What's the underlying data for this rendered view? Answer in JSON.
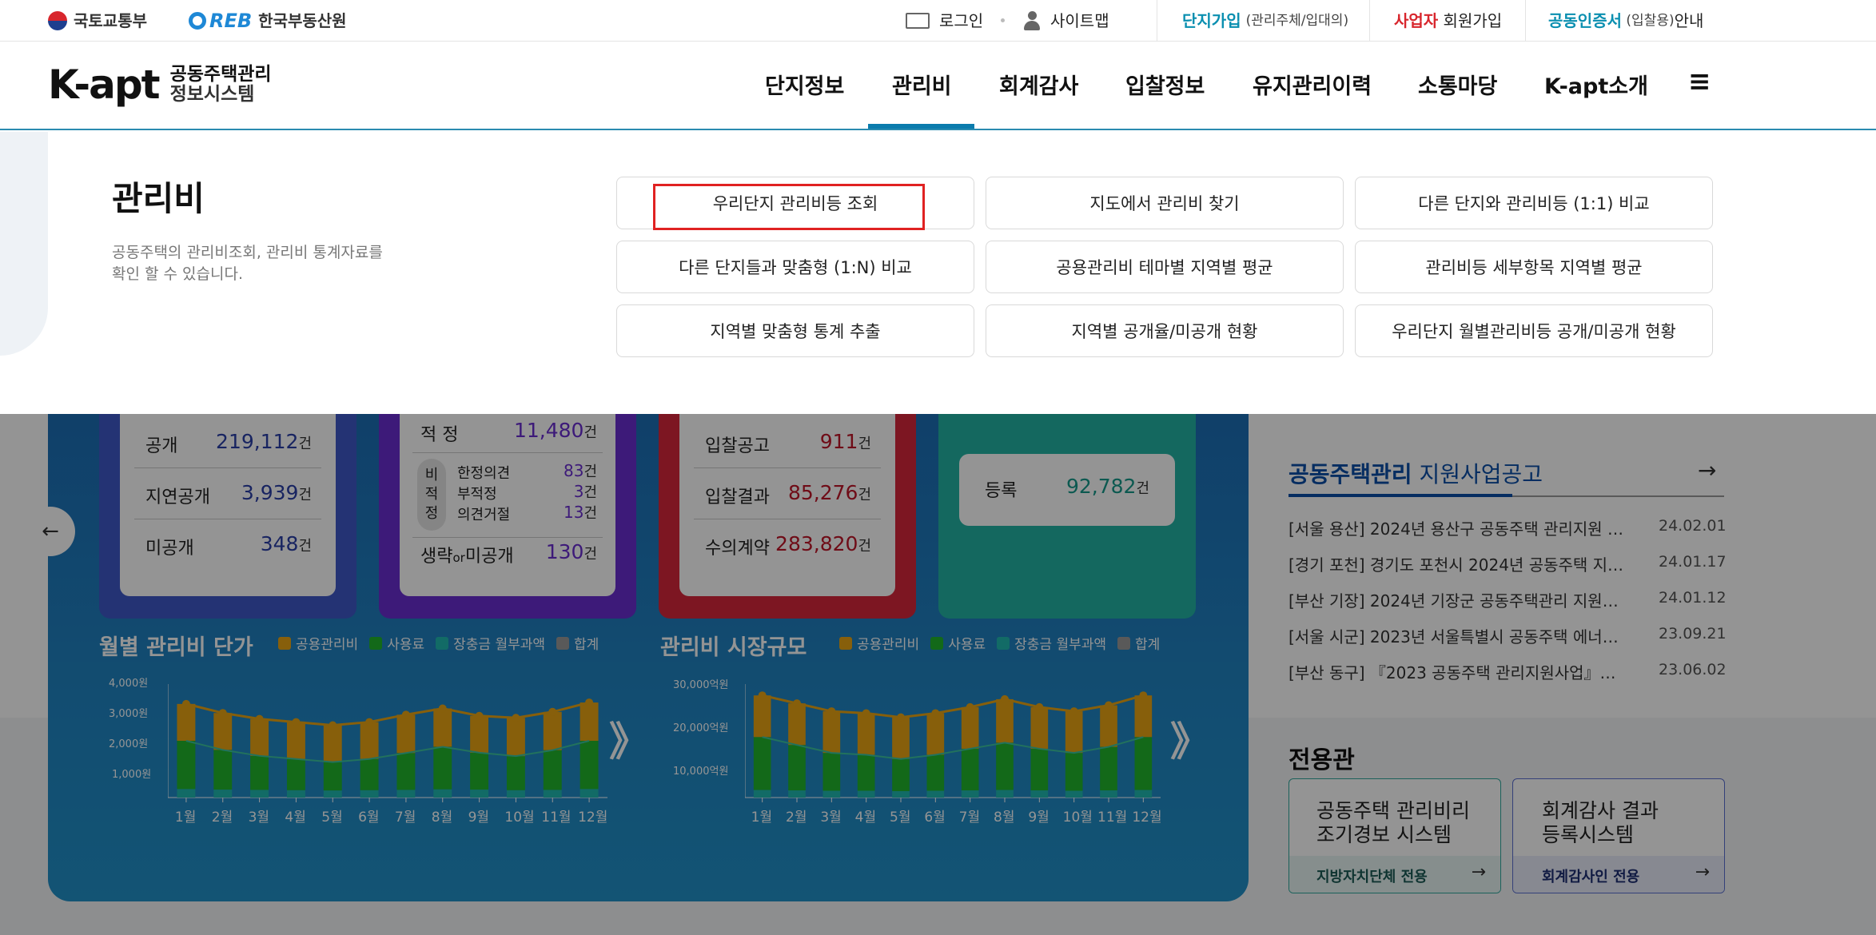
{
  "util": {
    "gov1": "국토교통부",
    "gov2_logo": "REB",
    "gov2": "한국부동산원",
    "login": "로그인",
    "sitemap": "사이트맵",
    "join_hl": "단지가입",
    "join_sub": "(관리주체/입대의)",
    "biz_hl": "사업자",
    "biz_rest": " 회원가입",
    "cert_hl": "공동인증서",
    "cert_sub": " (입찰용)",
    "cert_rest": "안내"
  },
  "logo": {
    "main": "K-apt",
    "line1": "공동주택관리",
    "line2": "정보시스템"
  },
  "nav": [
    "단지정보",
    "관리비",
    "회계감사",
    "입찰정보",
    "유지관리이력",
    "소통마당",
    "K-apt소개"
  ],
  "menu_icon": "≡",
  "mega": {
    "title": "관리비",
    "desc1": "공동주택의 관리비조회, 관리비 통계자료를",
    "desc2": "확인 할 수 있습니다.",
    "items": [
      "우리단지 관리비등 조회",
      "지도에서 관리비 찾기",
      "다른 단지와 관리비등 (1:1) 비교",
      "다른 단지들과 맞춤형 (1:N) 비교",
      "공용관리비 테마별 지역별 평균",
      "관리비등 세부항목 지역별 평균",
      "지역별 맞춤형 통계 추출",
      "지역별 공개율/미공개 현황",
      "우리단지 월별관리비등 공개/미공개 현황"
    ]
  },
  "stats": {
    "card1": [
      {
        "label": "공개",
        "value": "219,112",
        "unit": "건"
      },
      {
        "label": "지연공개",
        "value": "3,939",
        "unit": "건"
      },
      {
        "label": "미공개",
        "value": "348",
        "unit": "건"
      }
    ],
    "card2": {
      "top_label": "적 정",
      "top_value": "11,480",
      "unit": "건",
      "badge": [
        "비",
        "적",
        "정"
      ],
      "sub": [
        {
          "label": "한정의견",
          "value": "83"
        },
        {
          "label": "부적정",
          "value": "3"
        },
        {
          "label": "의견거절",
          "value": "13"
        }
      ],
      "bottom_label_a": "생략",
      "bottom_label_or": "or",
      "bottom_label_b": "미공개",
      "bottom_value": "130"
    },
    "card3": [
      {
        "label": "입찰공고",
        "value": "911",
        "unit": "건"
      },
      {
        "label": "입찰결과",
        "value": "85,276",
        "unit": "건"
      },
      {
        "label": "수의계약",
        "value": "283,820",
        "unit": "건"
      }
    ],
    "card4": {
      "label": "등록",
      "value": "92,782",
      "unit": "건"
    }
  },
  "legend": [
    "공용관리비",
    "사용료",
    "장충금 월부과액",
    "합계"
  ],
  "legend_colors": [
    "#e8a413",
    "#22b52c",
    "#20b8b0",
    "#999999"
  ],
  "arrow_glyph": "》",
  "chart_data": [
    {
      "type": "bar",
      "title": "월별 관리비 단가",
      "categories": [
        "1월",
        "2월",
        "3월",
        "4월",
        "5월",
        "6월",
        "7월",
        "8월",
        "9월",
        "10월",
        "11월",
        "12월"
      ],
      "yticks": [
        "4,000원",
        "3,000원",
        "2,000원",
        "1,000원"
      ],
      "ylim": [
        0,
        4000
      ],
      "series": [
        {
          "name": "장충금 월부과액",
          "values": [
            300,
            280,
            270,
            260,
            250,
            260,
            270,
            290,
            280,
            260,
            270,
            300
          ]
        },
        {
          "name": "사용료",
          "values": [
            1700,
            1400,
            1200,
            1100,
            1000,
            1100,
            1300,
            1500,
            1300,
            1200,
            1400,
            1700
          ]
        },
        {
          "name": "공용관리비",
          "values": [
            1300,
            1300,
            1300,
            1300,
            1300,
            1300,
            1350,
            1350,
            1300,
            1350,
            1350,
            1350
          ]
        },
        {
          "name": "합계",
          "values": [
            3300,
            2980,
            2770,
            2660,
            2550,
            2660,
            2920,
            3140,
            2880,
            2810,
            3020,
            3350
          ]
        }
      ]
    },
    {
      "type": "bar",
      "title": "관리비 시장규모",
      "categories": [
        "1월",
        "2월",
        "3월",
        "4월",
        "5월",
        "6월",
        "7월",
        "8월",
        "9월",
        "10월",
        "11월",
        "12월"
      ],
      "yticks": [
        "30,000억원",
        "20,000억원",
        "10,000억원"
      ],
      "ylim": [
        0,
        30000
      ],
      "series": [
        {
          "name": "장충금 월부과액",
          "values": [
            2000,
            1900,
            1800,
            1800,
            1700,
            1800,
            1900,
            2000,
            1900,
            1800,
            1900,
            2000
          ]
        },
        {
          "name": "사용료",
          "values": [
            14000,
            12000,
            10000,
            9500,
            8500,
            9500,
            11000,
            12500,
            11000,
            10000,
            11500,
            14000
          ]
        },
        {
          "name": "공용관리비",
          "values": [
            11000,
            11000,
            11000,
            11000,
            11000,
            11000,
            11000,
            11500,
            11000,
            11000,
            11000,
            11000
          ]
        },
        {
          "name": "합계",
          "values": [
            27000,
            24900,
            22800,
            22300,
            21200,
            22300,
            23900,
            26000,
            23900,
            22800,
            24400,
            27000
          ]
        }
      ]
    }
  ],
  "support": {
    "title_hl": "공동주택관리",
    "title_rest": " 지원사업공고",
    "items": [
      {
        "text": "[서울 용산] 2024년 용산구 공동주택 관리지원 …",
        "date": "24.02.01"
      },
      {
        "text": "[경기 포천] 경기도 포천시 2024년 공동주택 지…",
        "date": "24.01.17"
      },
      {
        "text": "[부산 기장] 2024년 기장군 공동주택관리 지원…",
        "date": "24.01.12"
      },
      {
        "text": "[서울 시군] 2023년 서울특별시 공동주택 에너…",
        "date": "23.09.21"
      },
      {
        "text": "[부산 동구] 『2023 공동주택 관리지원사업』…",
        "date": "23.06.02"
      }
    ]
  },
  "dedicated": {
    "title": "전용관",
    "box1": {
      "line1": "공동주택 관리비리",
      "line2": "조기경보 시스템",
      "foot": "지방자치단체 전용"
    },
    "box2": {
      "line1": "회계감사 결과",
      "line2": "등록시스템",
      "foot": "회계감사인 전용"
    }
  }
}
